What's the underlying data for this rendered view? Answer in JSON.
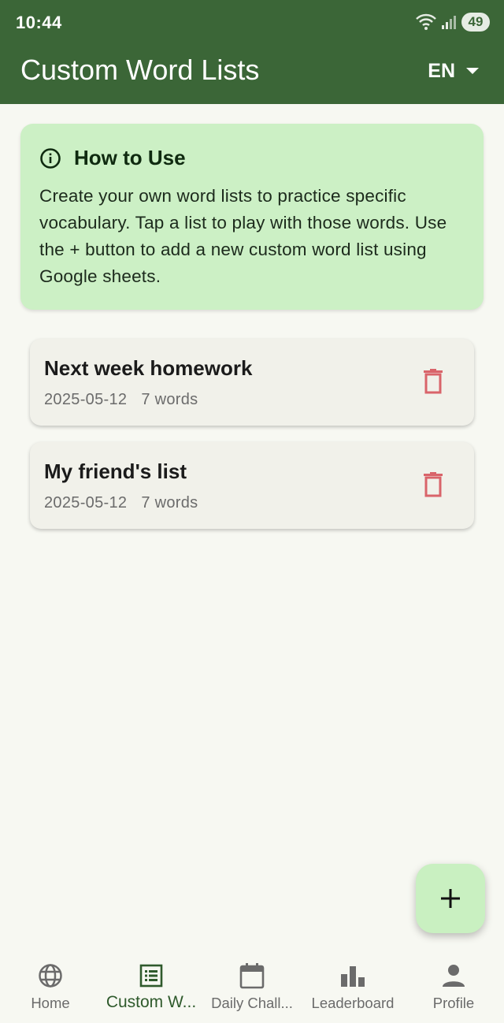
{
  "status_bar": {
    "time": "10:44",
    "battery": "49"
  },
  "app_bar": {
    "title": "Custom Word Lists",
    "language": "EN"
  },
  "info_card": {
    "title": "How to Use",
    "text": "Create your own word lists to practice specific vocabulary. Tap a list to play with those words. Use the + button to add a new custom word list using Google sheets."
  },
  "word_lists": [
    {
      "title": "Next week homework",
      "date": "2025-05-12",
      "count": "7 words"
    },
    {
      "title": "My friend's list",
      "date": "2025-05-12",
      "count": "7 words"
    }
  ],
  "fab": {
    "icon": "plus-icon"
  },
  "bottom_nav": [
    {
      "label": "Home",
      "icon": "globe-icon"
    },
    {
      "label": "Custom W...",
      "icon": "list-icon",
      "active": true
    },
    {
      "label": "Daily Chall...",
      "icon": "calendar-icon"
    },
    {
      "label": "Leaderboard",
      "icon": "bar-chart-icon"
    },
    {
      "label": "Profile",
      "icon": "person-icon"
    }
  ],
  "colors": {
    "app_bar": "#3b6637",
    "info_card": "#ccf0c5",
    "delete_icon": "#d9646a",
    "active_nav": "#2f5a2c",
    "fab": "#c9f0c1"
  }
}
